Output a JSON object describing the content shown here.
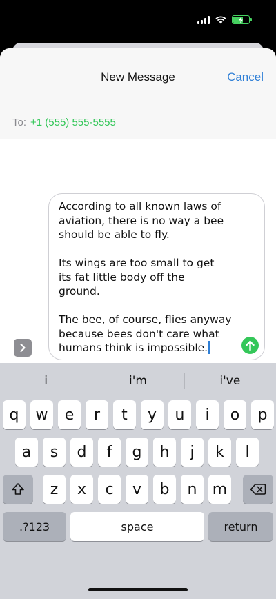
{
  "header": {
    "title": "New Message",
    "cancel_label": "Cancel"
  },
  "recipient": {
    "label": "To:",
    "value": "+1 (555) 555-5555"
  },
  "message": {
    "text": "According to all known laws of\naviation, there is no way a bee\nshould be able to fly.\n\nIts wings are too small to get\nits fat little body off the\nground.\n\nThe bee, of course, flies anyway\nbecause bees don't care what\nhumans think is impossible."
  },
  "suggestions": [
    "i",
    "i'm",
    "i've"
  ],
  "keyboard": {
    "row1": [
      "q",
      "w",
      "e",
      "r",
      "t",
      "y",
      "u",
      "i",
      "o",
      "p"
    ],
    "row2": [
      "a",
      "s",
      "d",
      "f",
      "g",
      "h",
      "j",
      "k",
      "l"
    ],
    "row3": [
      "z",
      "x",
      "c",
      "v",
      "b",
      "n",
      "m"
    ],
    "numbers_label": ".?123",
    "space_label": "space",
    "return_label": "return"
  },
  "colors": {
    "accent": "#2f7fd6",
    "recipient": "#34c759",
    "send_button": "#34c759",
    "battery": "#46d160"
  },
  "status": {
    "battery_level": 0.6
  },
  "icons": [
    "signal-icon",
    "wifi-icon",
    "battery-charging-icon",
    "chevron-right-icon",
    "arrow-up-icon",
    "shift-icon",
    "backspace-icon"
  ]
}
